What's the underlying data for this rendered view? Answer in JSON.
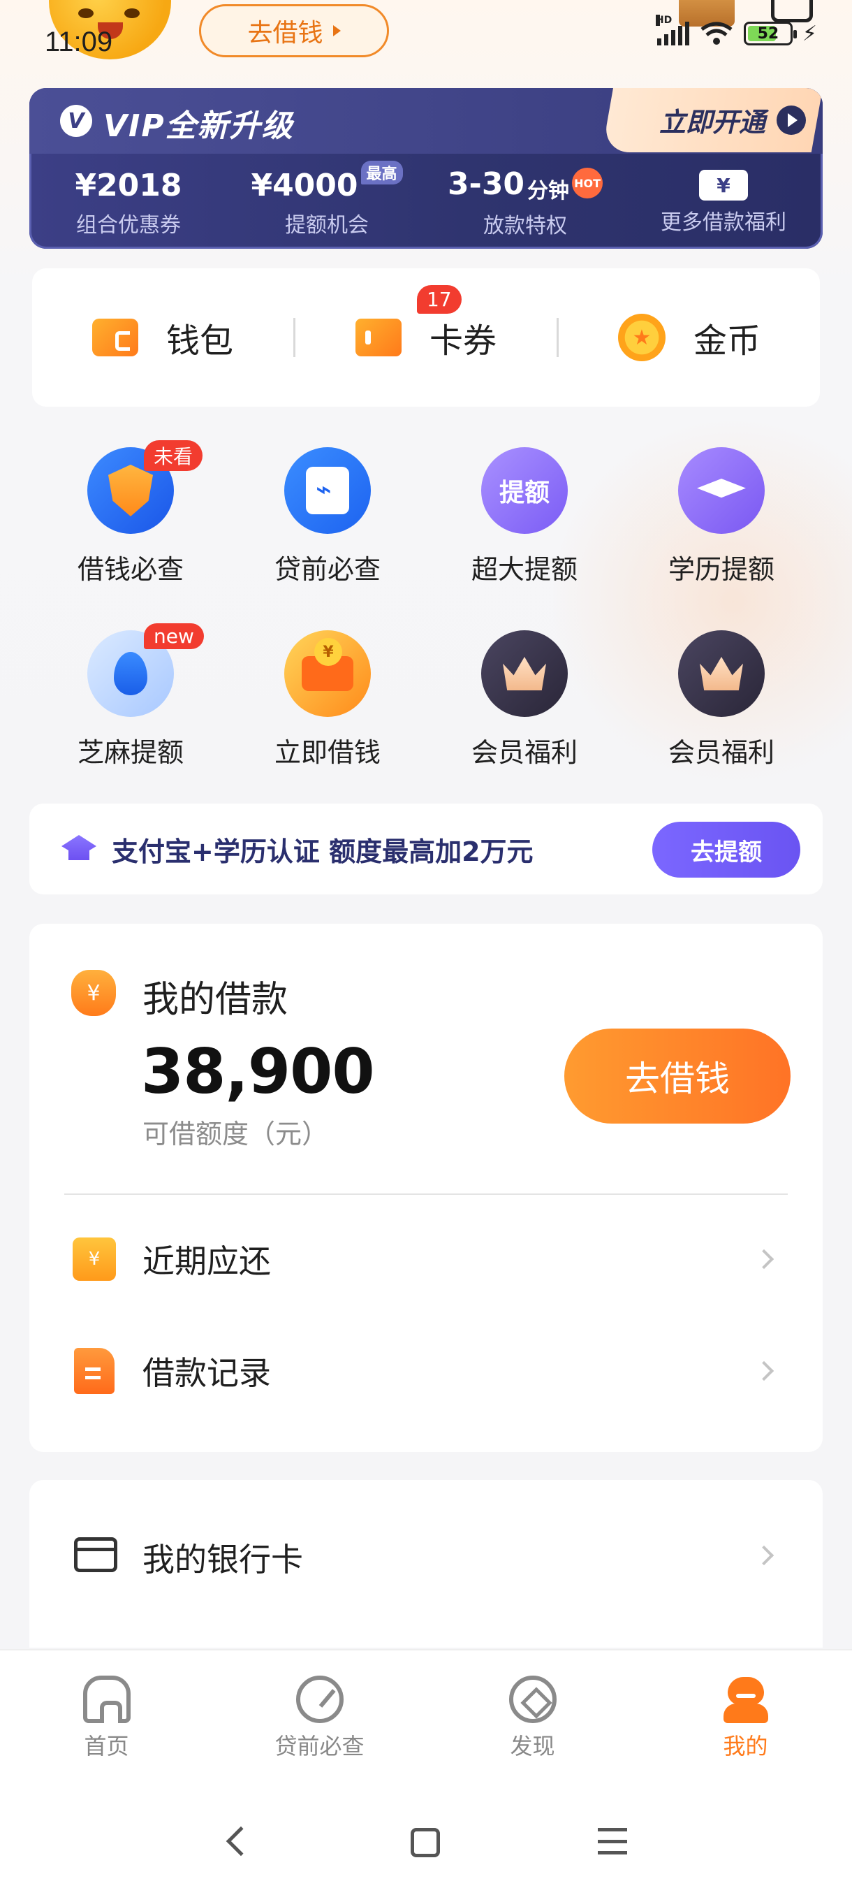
{
  "status_bar": {
    "time": "11:09",
    "battery": "52",
    "network": "HD"
  },
  "top": {
    "borrow_button": "去借钱"
  },
  "vip_banner": {
    "title": "VIP全新升级",
    "open_button": "立即开通",
    "benefits": [
      {
        "value": "¥2018",
        "label": "组合优惠券"
      },
      {
        "value": "¥4000",
        "tag": "最高",
        "label": "提额机会"
      },
      {
        "value": "3-30",
        "unit": "分钟",
        "tag": "HOT",
        "label": "放款特权"
      },
      {
        "value": "¥",
        "label": "更多借款福利"
      }
    ]
  },
  "wallet": {
    "items": [
      {
        "label": "钱包",
        "icon": "wallet-icon"
      },
      {
        "label": "卡券",
        "icon": "ticket-icon",
        "badge": "17"
      },
      {
        "label": "金币",
        "icon": "coin-icon"
      }
    ]
  },
  "grid": {
    "items": [
      {
        "label": "借钱必查",
        "icon": "shield-icon",
        "badge": "未看"
      },
      {
        "label": "贷前必查",
        "icon": "document-check-icon"
      },
      {
        "label": "超大提额",
        "icon": "gift-icon",
        "icon_text": "提额"
      },
      {
        "label": "学历提额",
        "icon": "graduation-cap-icon"
      },
      {
        "label": "芝麻提额",
        "icon": "drop-icon",
        "badge": "new"
      },
      {
        "label": "立即借钱",
        "icon": "wallet-coin-icon",
        "icon_text": "¥"
      },
      {
        "label": "会员福利",
        "icon": "crown-icon"
      },
      {
        "label": "会员福利",
        "icon": "crown-icon"
      }
    ]
  },
  "promo": {
    "text": "支付宝+学历认证 额度最高加2万元",
    "button": "去提额"
  },
  "loan": {
    "title": "我的借款",
    "amount": "38,900",
    "subtitle": "可借额度（元）",
    "button": "去借钱",
    "rows": [
      {
        "label": "近期应还",
        "icon": "calendar-icon"
      },
      {
        "label": "借款记录",
        "icon": "document-icon"
      }
    ]
  },
  "bank": {
    "label": "我的银行卡"
  },
  "tab_bar": {
    "tabs": [
      {
        "label": "首页",
        "icon": "home-icon"
      },
      {
        "label": "贷前必查",
        "icon": "gauge-icon"
      },
      {
        "label": "发现",
        "icon": "discover-icon"
      },
      {
        "label": "我的",
        "icon": "profile-icon",
        "active": true
      }
    ]
  },
  "colors": {
    "accent": "#ff7a1a",
    "vip_bg": "#2f346f",
    "promo_button": "#6a54f2",
    "badge_red": "#f23c2f"
  }
}
